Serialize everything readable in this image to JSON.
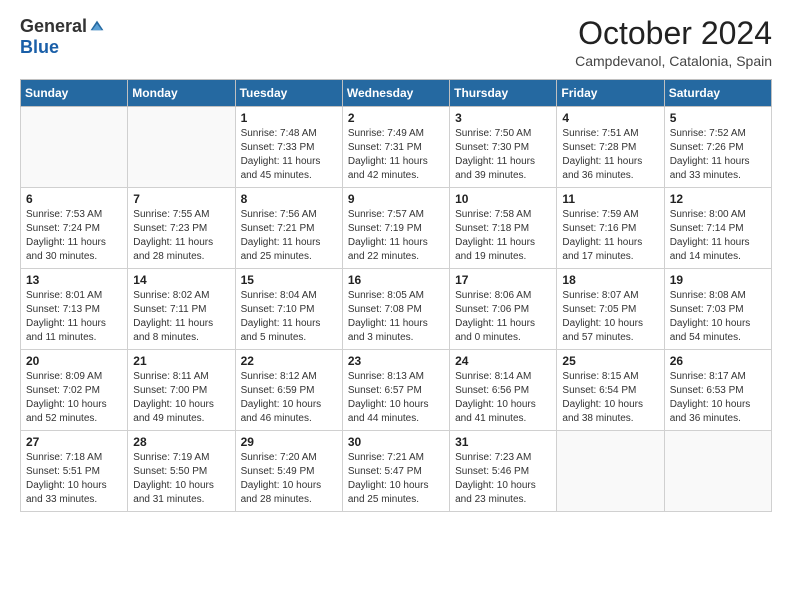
{
  "header": {
    "logo_general": "General",
    "logo_blue": "Blue",
    "month_title": "October 2024",
    "location": "Campdevanol, Catalonia, Spain"
  },
  "days_of_week": [
    "Sunday",
    "Monday",
    "Tuesday",
    "Wednesday",
    "Thursday",
    "Friday",
    "Saturday"
  ],
  "weeks": [
    [
      {
        "day": "",
        "sunrise": "",
        "sunset": "",
        "daylight": ""
      },
      {
        "day": "",
        "sunrise": "",
        "sunset": "",
        "daylight": ""
      },
      {
        "day": "1",
        "sunrise": "Sunrise: 7:48 AM",
        "sunset": "Sunset: 7:33 PM",
        "daylight": "Daylight: 11 hours and 45 minutes."
      },
      {
        "day": "2",
        "sunrise": "Sunrise: 7:49 AM",
        "sunset": "Sunset: 7:31 PM",
        "daylight": "Daylight: 11 hours and 42 minutes."
      },
      {
        "day": "3",
        "sunrise": "Sunrise: 7:50 AM",
        "sunset": "Sunset: 7:30 PM",
        "daylight": "Daylight: 11 hours and 39 minutes."
      },
      {
        "day": "4",
        "sunrise": "Sunrise: 7:51 AM",
        "sunset": "Sunset: 7:28 PM",
        "daylight": "Daylight: 11 hours and 36 minutes."
      },
      {
        "day": "5",
        "sunrise": "Sunrise: 7:52 AM",
        "sunset": "Sunset: 7:26 PM",
        "daylight": "Daylight: 11 hours and 33 minutes."
      }
    ],
    [
      {
        "day": "6",
        "sunrise": "Sunrise: 7:53 AM",
        "sunset": "Sunset: 7:24 PM",
        "daylight": "Daylight: 11 hours and 30 minutes."
      },
      {
        "day": "7",
        "sunrise": "Sunrise: 7:55 AM",
        "sunset": "Sunset: 7:23 PM",
        "daylight": "Daylight: 11 hours and 28 minutes."
      },
      {
        "day": "8",
        "sunrise": "Sunrise: 7:56 AM",
        "sunset": "Sunset: 7:21 PM",
        "daylight": "Daylight: 11 hours and 25 minutes."
      },
      {
        "day": "9",
        "sunrise": "Sunrise: 7:57 AM",
        "sunset": "Sunset: 7:19 PM",
        "daylight": "Daylight: 11 hours and 22 minutes."
      },
      {
        "day": "10",
        "sunrise": "Sunrise: 7:58 AM",
        "sunset": "Sunset: 7:18 PM",
        "daylight": "Daylight: 11 hours and 19 minutes."
      },
      {
        "day": "11",
        "sunrise": "Sunrise: 7:59 AM",
        "sunset": "Sunset: 7:16 PM",
        "daylight": "Daylight: 11 hours and 17 minutes."
      },
      {
        "day": "12",
        "sunrise": "Sunrise: 8:00 AM",
        "sunset": "Sunset: 7:14 PM",
        "daylight": "Daylight: 11 hours and 14 minutes."
      }
    ],
    [
      {
        "day": "13",
        "sunrise": "Sunrise: 8:01 AM",
        "sunset": "Sunset: 7:13 PM",
        "daylight": "Daylight: 11 hours and 11 minutes."
      },
      {
        "day": "14",
        "sunrise": "Sunrise: 8:02 AM",
        "sunset": "Sunset: 7:11 PM",
        "daylight": "Daylight: 11 hours and 8 minutes."
      },
      {
        "day": "15",
        "sunrise": "Sunrise: 8:04 AM",
        "sunset": "Sunset: 7:10 PM",
        "daylight": "Daylight: 11 hours and 5 minutes."
      },
      {
        "day": "16",
        "sunrise": "Sunrise: 8:05 AM",
        "sunset": "Sunset: 7:08 PM",
        "daylight": "Daylight: 11 hours and 3 minutes."
      },
      {
        "day": "17",
        "sunrise": "Sunrise: 8:06 AM",
        "sunset": "Sunset: 7:06 PM",
        "daylight": "Daylight: 11 hours and 0 minutes."
      },
      {
        "day": "18",
        "sunrise": "Sunrise: 8:07 AM",
        "sunset": "Sunset: 7:05 PM",
        "daylight": "Daylight: 10 hours and 57 minutes."
      },
      {
        "day": "19",
        "sunrise": "Sunrise: 8:08 AM",
        "sunset": "Sunset: 7:03 PM",
        "daylight": "Daylight: 10 hours and 54 minutes."
      }
    ],
    [
      {
        "day": "20",
        "sunrise": "Sunrise: 8:09 AM",
        "sunset": "Sunset: 7:02 PM",
        "daylight": "Daylight: 10 hours and 52 minutes."
      },
      {
        "day": "21",
        "sunrise": "Sunrise: 8:11 AM",
        "sunset": "Sunset: 7:00 PM",
        "daylight": "Daylight: 10 hours and 49 minutes."
      },
      {
        "day": "22",
        "sunrise": "Sunrise: 8:12 AM",
        "sunset": "Sunset: 6:59 PM",
        "daylight": "Daylight: 10 hours and 46 minutes."
      },
      {
        "day": "23",
        "sunrise": "Sunrise: 8:13 AM",
        "sunset": "Sunset: 6:57 PM",
        "daylight": "Daylight: 10 hours and 44 minutes."
      },
      {
        "day": "24",
        "sunrise": "Sunrise: 8:14 AM",
        "sunset": "Sunset: 6:56 PM",
        "daylight": "Daylight: 10 hours and 41 minutes."
      },
      {
        "day": "25",
        "sunrise": "Sunrise: 8:15 AM",
        "sunset": "Sunset: 6:54 PM",
        "daylight": "Daylight: 10 hours and 38 minutes."
      },
      {
        "day": "26",
        "sunrise": "Sunrise: 8:17 AM",
        "sunset": "Sunset: 6:53 PM",
        "daylight": "Daylight: 10 hours and 36 minutes."
      }
    ],
    [
      {
        "day": "27",
        "sunrise": "Sunrise: 7:18 AM",
        "sunset": "Sunset: 5:51 PM",
        "daylight": "Daylight: 10 hours and 33 minutes."
      },
      {
        "day": "28",
        "sunrise": "Sunrise: 7:19 AM",
        "sunset": "Sunset: 5:50 PM",
        "daylight": "Daylight: 10 hours and 31 minutes."
      },
      {
        "day": "29",
        "sunrise": "Sunrise: 7:20 AM",
        "sunset": "Sunset: 5:49 PM",
        "daylight": "Daylight: 10 hours and 28 minutes."
      },
      {
        "day": "30",
        "sunrise": "Sunrise: 7:21 AM",
        "sunset": "Sunset: 5:47 PM",
        "daylight": "Daylight: 10 hours and 25 minutes."
      },
      {
        "day": "31",
        "sunrise": "Sunrise: 7:23 AM",
        "sunset": "Sunset: 5:46 PM",
        "daylight": "Daylight: 10 hours and 23 minutes."
      },
      {
        "day": "",
        "sunrise": "",
        "sunset": "",
        "daylight": ""
      },
      {
        "day": "",
        "sunrise": "",
        "sunset": "",
        "daylight": ""
      }
    ]
  ]
}
